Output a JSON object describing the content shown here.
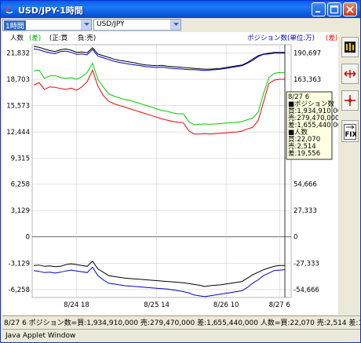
{
  "window": {
    "title": "USD/JPY-1時間",
    "minimize_icon": "minimize-icon",
    "maximize_icon": "maximize-icon",
    "close_icon": "close-icon"
  },
  "toolbar": {
    "period_value": "1時間",
    "pair_value": "USD/JPY"
  },
  "legend": {
    "left_label": "人数",
    "left_badge": "(差)",
    "mid_label": "(正:買",
    "mid_label2": "負:売)",
    "right_label": "ポジション数(単位:万)",
    "right_badge": "(差)"
  },
  "colors": {
    "black_series": "#000000",
    "blue_series": "#0000cc",
    "green_series": "#00cc00",
    "red_series": "#ee0000",
    "grid": "#c8c8c8",
    "left_axis_text": "#000000",
    "right_axis_text": "#000000",
    "right_badge": "#ff0000",
    "left_badge": "#00aa00",
    "right_label": "#0000cc"
  },
  "axes": {
    "left_ticks": [
      "21,832",
      "18,703",
      "15,573",
      "12,444",
      "9,315",
      "6,258",
      "3,129",
      "0",
      "-3,129",
      "-6,258"
    ],
    "right_ticks": [
      "190,697",
      "163,363",
      "",
      "",
      "",
      "54,666",
      "27,333",
      "0",
      "-27,333",
      "-54,666"
    ],
    "x_ticks": [
      "8/24 18",
      "8/25 14",
      "8/26 10",
      "8/27 6"
    ]
  },
  "tooltip": {
    "lines": [
      "8/27 6",
      "■ポジション数",
      "買:1,934,910,000",
      "売:279,470,000",
      "差:1,655,440,000",
      "■人数",
      "買:22,070",
      "売:2,514",
      "差:19,556"
    ]
  },
  "status": {
    "text": "8/27 6  ポジション数=買:1,934,910,000 売:279,470,000 差:1,655,440,000 人数=買:22,070 売:2,514 差:19,556"
  },
  "applet_bar": {
    "text": "Java Applet Window"
  },
  "side_tools": [
    {
      "name": "candle-chart-icon"
    },
    {
      "name": "expand-horizontal-icon"
    },
    {
      "name": "crosshair-icon"
    },
    {
      "name": "fix-icon",
      "label": "FIX"
    }
  ],
  "chart_data": {
    "type": "line",
    "x_labels": [
      "8/24 18",
      "8/25 14",
      "8/26 10",
      "8/27 6"
    ],
    "series": [
      {
        "color": "#000000",
        "values": [
          22600,
          22500,
          22300,
          22100,
          22000,
          22200,
          22300,
          22150,
          21900,
          21950,
          21850,
          22450,
          21700,
          21500,
          21300,
          21100,
          20950,
          20850,
          20750,
          20650,
          20500,
          20400,
          20350,
          20300,
          20350,
          20250,
          20200,
          20150,
          20100,
          20050,
          20000,
          19950,
          19900,
          19900,
          19950,
          20000,
          20100,
          20200,
          20300,
          20400,
          20700,
          21100,
          21500,
          21700,
          21800,
          21900,
          21900,
          21900
        ]
      },
      {
        "color": "#0000cc",
        "values": [
          22300,
          22200,
          22000,
          21850,
          21750,
          22000,
          22050,
          21900,
          21650,
          21700,
          21600,
          22250,
          21450,
          21250,
          21050,
          20850,
          20700,
          20600,
          20500,
          20400,
          20300,
          20200,
          20150,
          20100,
          20150,
          20050,
          20000,
          19950,
          19900,
          19850,
          19850,
          19800,
          19750,
          19800,
          19850,
          19900,
          20000,
          20100,
          20200,
          20300,
          20600,
          20950,
          21400,
          21650,
          21700,
          21800,
          21800,
          21800
        ]
      },
      {
        "color": "#00cc00",
        "values": [
          19700,
          19800,
          18800,
          19100,
          19150,
          18900,
          18800,
          18900,
          18700,
          19000,
          19500,
          20600,
          18700,
          17800,
          17000,
          16700,
          16500,
          16300,
          16200,
          16000,
          15800,
          15600,
          15400,
          15200,
          15000,
          14900,
          14700,
          14600,
          14600,
          13700,
          13300,
          13350,
          13400,
          13350,
          13400,
          13450,
          13500,
          13550,
          13600,
          13700,
          13900,
          14100,
          14800,
          17000,
          18900,
          19400,
          19500,
          19500
        ]
      },
      {
        "color": "#ee0000",
        "values": [
          18000,
          18300,
          17500,
          17800,
          17750,
          17600,
          17500,
          17650,
          17400,
          17800,
          18400,
          19800,
          17900,
          16800,
          16100,
          15800,
          15600,
          15400,
          15200,
          15000,
          14800,
          14600,
          14400,
          14200,
          14000,
          13850,
          13700,
          13600,
          13550,
          12600,
          12200,
          12200,
          12250,
          12200,
          12250,
          12300,
          12350,
          12400,
          12450,
          12550,
          12800,
          13000,
          13800,
          16000,
          18200,
          18600,
          18700,
          18700
        ]
      },
      {
        "color": "#000000",
        "values": [
          -3400,
          -3350,
          -3500,
          -3450,
          -3550,
          -3500,
          -3300,
          -3200,
          -3300,
          -3400,
          -3500,
          -2900,
          -3800,
          -4200,
          -4600,
          -4700,
          -4800,
          -4900,
          -4950,
          -5000,
          -5050,
          -5100,
          -5150,
          -5200,
          -5250,
          -5300,
          -5350,
          -5400,
          -5450,
          -5550,
          -5650,
          -5750,
          -5900,
          -5800,
          -5750,
          -5700,
          -5600,
          -5500,
          -5400,
          -5300,
          -4900,
          -4500,
          -4200,
          -3900,
          -3700,
          -3500,
          -3400,
          -3400
        ]
      },
      {
        "color": "#0000cc",
        "values": [
          -4000,
          -4100,
          -4250,
          -4200,
          -4300,
          -4200,
          -4050,
          -3950,
          -4050,
          -4150,
          -4250,
          -3600,
          -4600,
          -5100,
          -5500,
          -5600,
          -5700,
          -5800,
          -5850,
          -5900,
          -5950,
          -6000,
          -6050,
          -6100,
          -6150,
          -6200,
          -6300,
          -6400,
          -6500,
          -6650,
          -6900,
          -7000,
          -7100,
          -7000,
          -6900,
          -6800,
          -6700,
          -6600,
          -6500,
          -6400,
          -6000,
          -5500,
          -5100,
          -4600,
          -4300,
          -4000,
          -3950,
          -3900
        ]
      }
    ],
    "ylim_left": [
      -7200,
      22800
    ],
    "grid": true
  }
}
